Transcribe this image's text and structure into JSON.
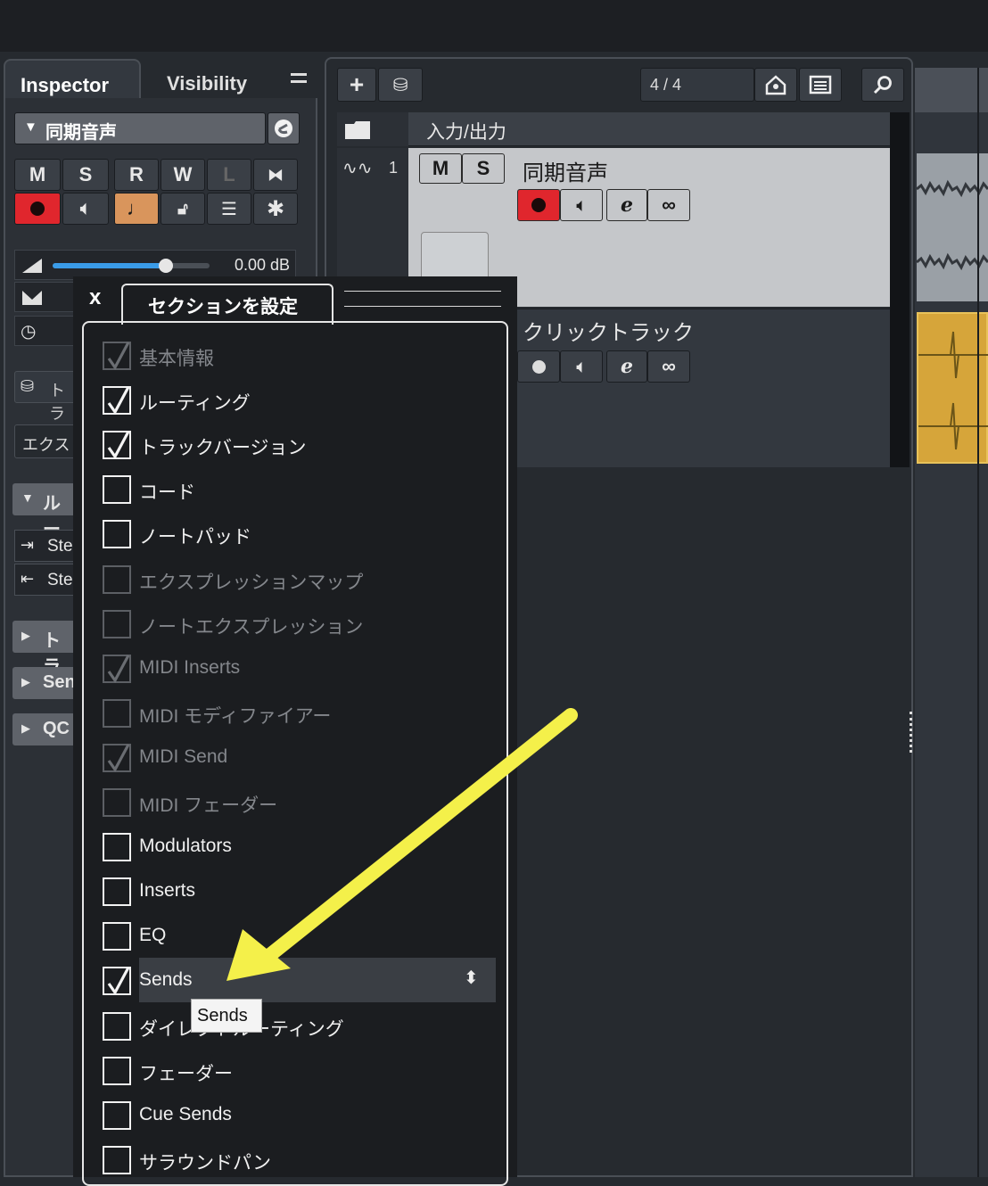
{
  "inspector": {
    "tab_inspector": "Inspector",
    "tab_visibility": "Visibility",
    "track_name": "同期音声",
    "btn_m": "M",
    "btn_s": "S",
    "btn_r": "R",
    "btn_w": "W",
    "btn_l": "L",
    "volume_value": "0.00 dB",
    "volume_level": 0.72,
    "section_routing": "ルー",
    "routing_in": "Ste",
    "routing_out": "Ste",
    "section_track": "トラ",
    "section_sends": "Sen",
    "section_qc": "QC",
    "chord_partial": "トラ",
    "expression_partial": "エクス"
  },
  "toolbar": {
    "time_signature": "4 / 4"
  },
  "tracks": {
    "folder_label": "入力/出力",
    "track1_number": "1",
    "track1_name": "同期音声",
    "track1_m": "M",
    "track1_s": "S",
    "track2_name": "クリックトラック"
  },
  "popup": {
    "close_label": "x",
    "title": "セクションを設定",
    "items": [
      {
        "label": "基本情報",
        "checked": true,
        "enabled": false
      },
      {
        "label": "ルーティング",
        "checked": true,
        "enabled": true
      },
      {
        "label": "トラックバージョン",
        "checked": true,
        "enabled": true
      },
      {
        "label": "コード",
        "checked": false,
        "enabled": true
      },
      {
        "label": "ノートパッド",
        "checked": false,
        "enabled": true
      },
      {
        "label": "エクスプレッションマップ",
        "checked": false,
        "enabled": false
      },
      {
        "label": "ノートエクスプレッション",
        "checked": false,
        "enabled": false
      },
      {
        "label": "MIDI Inserts",
        "checked": true,
        "enabled": false
      },
      {
        "label": "MIDI モディファイアー",
        "checked": false,
        "enabled": false
      },
      {
        "label": "MIDI Send",
        "checked": true,
        "enabled": false
      },
      {
        "label": "MIDI フェーダー",
        "checked": false,
        "enabled": false
      },
      {
        "label": "Modulators",
        "checked": false,
        "enabled": true
      },
      {
        "label": "Inserts",
        "checked": false,
        "enabled": true
      },
      {
        "label": "EQ",
        "checked": false,
        "enabled": true
      },
      {
        "label": "Sends",
        "checked": true,
        "enabled": true
      },
      {
        "label": "ダイレクトルーティング",
        "checked": false,
        "enabled": true
      },
      {
        "label": "フェーダー",
        "checked": false,
        "enabled": true
      },
      {
        "label": "Cue Sends",
        "checked": false,
        "enabled": true
      },
      {
        "label": "サラウンドパン",
        "checked": false,
        "enabled": true
      }
    ],
    "tooltip": "Sends"
  },
  "colors": {
    "accent_red": "#e0262d",
    "accent_orange": "#d9955c",
    "volume_blue": "#3a9be8",
    "clip_yellow": "#d6a53a",
    "arrow_yellow": "#f4f04a"
  }
}
